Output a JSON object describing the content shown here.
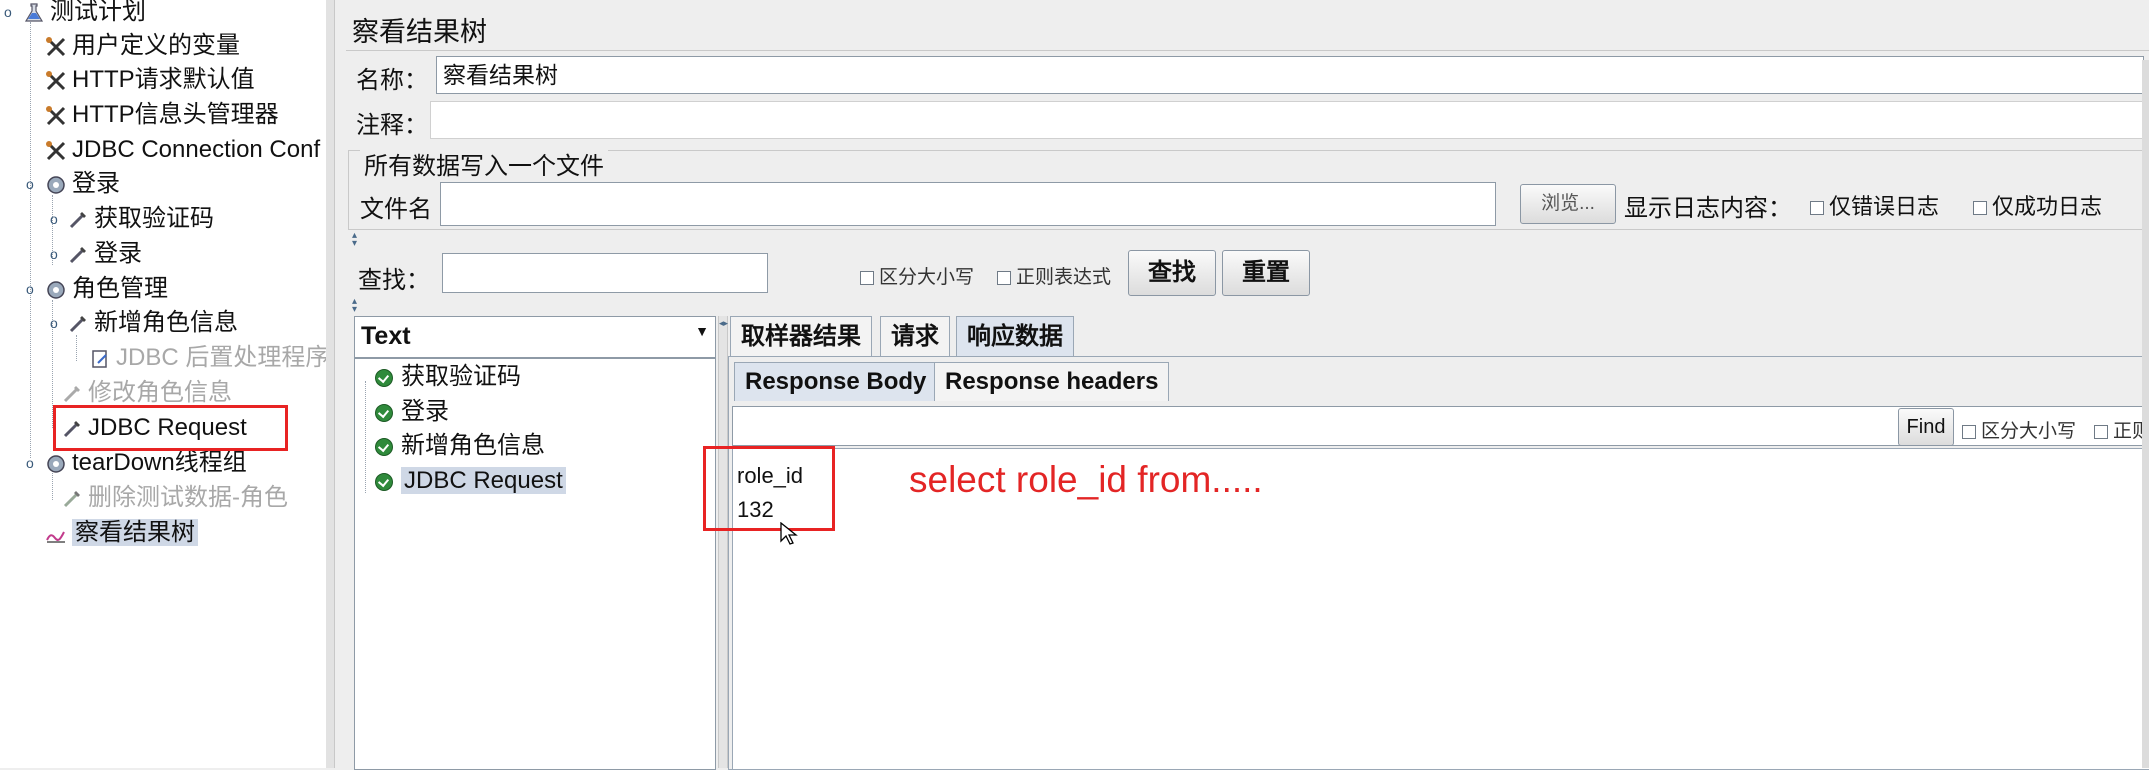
{
  "tree": {
    "items": [
      {
        "label": "测试计划",
        "icon": "flask-icon",
        "disabled": false
      },
      {
        "label": "用户定义的变量",
        "icon": "wrench-icon",
        "disabled": false
      },
      {
        "label": "HTTP请求默认值",
        "icon": "wrench-icon",
        "disabled": false
      },
      {
        "label": "HTTP信息头管理器",
        "icon": "wrench-icon",
        "disabled": false
      },
      {
        "label": "JDBC Connection Conf",
        "icon": "wrench-icon",
        "disabled": false
      },
      {
        "label": "登录",
        "icon": "gear-icon",
        "disabled": false
      },
      {
        "label": "获取验证码",
        "icon": "pipette-icon",
        "disabled": false
      },
      {
        "label": "登录",
        "icon": "pipette-icon",
        "disabled": false
      },
      {
        "label": "角色管理",
        "icon": "gear-icon",
        "disabled": false
      },
      {
        "label": "新增角色信息",
        "icon": "pipette-icon",
        "disabled": false
      },
      {
        "label": "JDBC 后置处理程序",
        "icon": "script-icon",
        "disabled": true
      },
      {
        "label": "修改角色信息",
        "icon": "pipette-icon",
        "disabled": true
      },
      {
        "label": "JDBC Request",
        "icon": "pipette-icon",
        "disabled": false
      },
      {
        "label": "tearDown线程组",
        "icon": "gear-icon",
        "disabled": false
      },
      {
        "label": "删除测试数据-角色",
        "icon": "pipette-icon",
        "disabled": true
      },
      {
        "label": "察看结果树",
        "icon": "chart-icon",
        "disabled": false
      }
    ]
  },
  "panel": {
    "title": "察看结果树",
    "name_label": "名称：",
    "name_value": "察看结果树",
    "comment_label": "注释：",
    "comment_value": "",
    "file_section_title": "所有数据写入一个文件",
    "filename_label": "文件名",
    "filename_value": "",
    "browse_label": "浏览...",
    "log_label": "显示日志内容：",
    "errors_only_label": "仅错误日志",
    "success_only_label": "仅成功日志"
  },
  "search": {
    "label": "查找：",
    "value": "",
    "case_label": "区分大小写",
    "regex_label": "正则表达式",
    "find_button": "查找",
    "reset_button": "重置"
  },
  "results": {
    "renderer": "Text",
    "items": [
      "获取验证码",
      "登录",
      "新增角色信息",
      "JDBC Request"
    ]
  },
  "detail_tabs": [
    "取样器结果",
    "请求",
    "响应数据"
  ],
  "response_tabs": [
    "Response Body",
    "Response headers"
  ],
  "response_find": {
    "value": "",
    "find_label": "Find",
    "case_label": "区分大小写",
    "regex_label": "正则"
  },
  "response_body": [
    "role_id",
    "132"
  ],
  "annotation": "select role_id from....."
}
